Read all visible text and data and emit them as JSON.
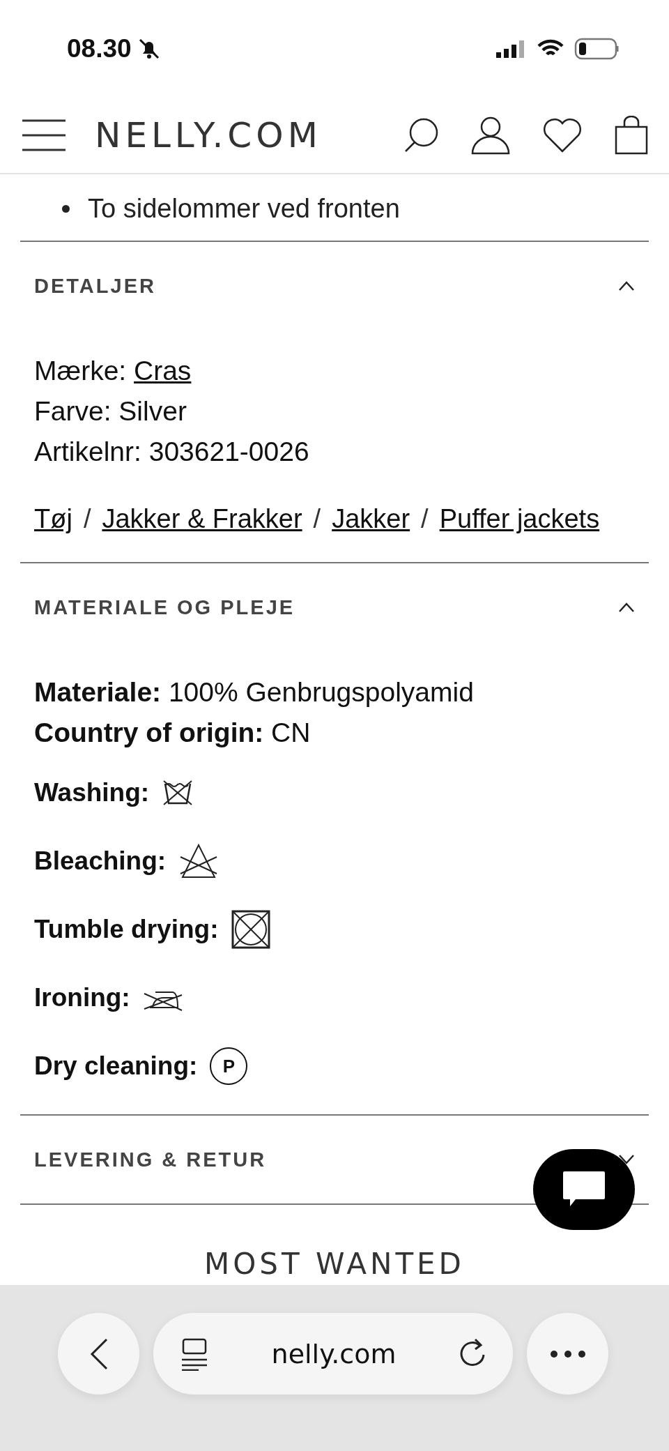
{
  "status_bar": {
    "time": "08.30",
    "silent": true
  },
  "header": {
    "logo": "NELLY.COM"
  },
  "description": {
    "bullets": [
      "To sidelommer ved fronten"
    ]
  },
  "sections": [
    {
      "kind": "details",
      "title": "DETALJER",
      "expanded": true,
      "lines": [
        {
          "text": "Mærke: ",
          "link": "Cras"
        },
        {
          "text": "Farve: Silver"
        },
        {
          "text": "Artikelnr: 303621-0026"
        }
      ],
      "separator": "/",
      "breadcrumbs": [
        "Tøj",
        "Jakker & Frakker",
        "Jakker",
        "Puffer jackets"
      ]
    },
    {
      "kind": "care",
      "title": "MATERIALE OG PLEJE",
      "expanded": true,
      "lines": [
        "**Materiale:** 100% Genbrugspolyamid",
        "**Country of origin:** CN"
      ],
      "care": [
        {
          "label": "Washing:",
          "kind": "no-wash"
        },
        {
          "label": "Bleaching:",
          "kind": "no-bleach"
        },
        {
          "label": "Tumble drying:",
          "kind": "no-tumble"
        },
        {
          "label": "Ironing:",
          "kind": "no-iron"
        },
        {
          "label": "Dry cleaning:",
          "kind": "dry-clean-p",
          "letter": "P"
        }
      ]
    },
    {
      "title": "LEVERING & RETUR",
      "expanded": false
    }
  ],
  "most_wanted": {
    "title": "MOST WANTED"
  },
  "browser_bar": {
    "url": "nelly.com"
  }
}
